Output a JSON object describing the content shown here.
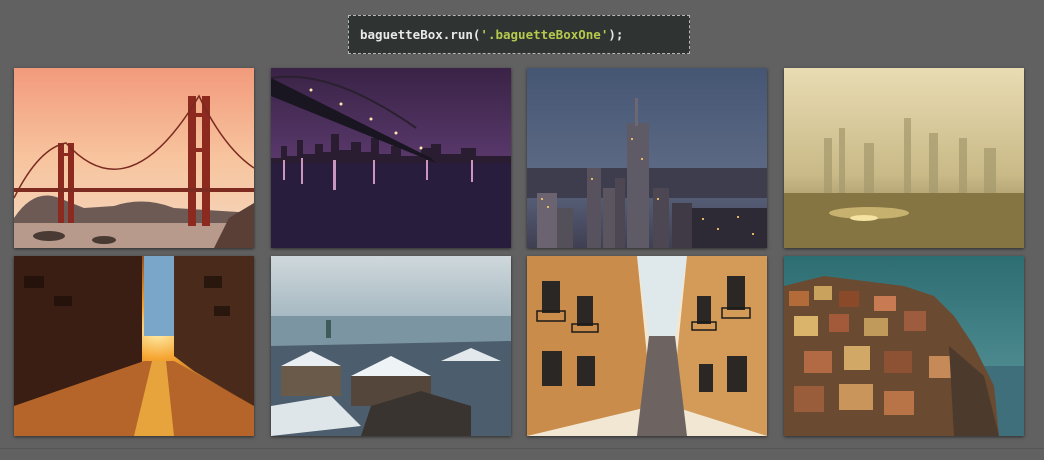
{
  "code_snippet": {
    "prefix": "baguetteBox.run(",
    "argument": "'.baguetteBoxOne'",
    "suffix": ");"
  },
  "gallery": {
    "class_name": "baguetteBoxOne",
    "items": [
      {
        "subject": "golden-gate-bridge-sunset"
      },
      {
        "subject": "brooklyn-bridge-night-skyline"
      },
      {
        "subject": "city-skyscrapers-dusk"
      },
      {
        "subject": "hazy-skyline-over-water"
      },
      {
        "subject": "sunset-street-between-buildings"
      },
      {
        "subject": "snowy-rooftops-old-town"
      },
      {
        "subject": "narrow-street-with-balconies"
      },
      {
        "subject": "cliffside-colorful-village"
      }
    ]
  },
  "colors": {
    "page_background": "#616161",
    "code_background": "#2f3331",
    "code_text": "#e8e8e8",
    "code_string": "#b5c94e"
  }
}
